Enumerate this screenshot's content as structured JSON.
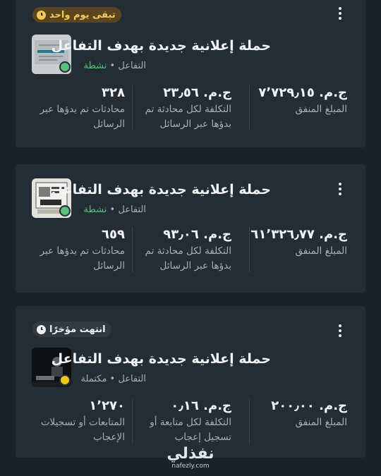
{
  "campaigns": [
    {
      "badge": "تبقى يوم واحد",
      "title": "حملة إعلانية جديدة بهدف التفاعل",
      "objective": "التفاعل",
      "status": "نشطة",
      "metrics": [
        {
          "value": "ج.م. ٧٬٧٢٩٫١٥",
          "label": "المبلغ المنفق"
        },
        {
          "value": "ج.م. ٢٣٫٥٦",
          "label": "التكلفة لكل محادثة تم بدؤها عبر الرسائل"
        },
        {
          "value": "٣٢٨",
          "label": "محادثات تم بدؤها عبر الرسائل"
        }
      ]
    },
    {
      "badge": "",
      "title": "حملة إعلانية جديدة بهدف التفاعل",
      "objective": "التفاعل",
      "status": "نشطة",
      "metrics": [
        {
          "value": "ج.م. ٦١٬٣٢٦٫٧٧",
          "label": "المبلغ المنفق"
        },
        {
          "value": "ج.م. ٩٣٫٠٦",
          "label": "التكلفة لكل محادثة تم بدؤها عبر الرسائل"
        },
        {
          "value": "٦٥٩",
          "label": "محادثات تم بدؤها عبر الرسائل"
        }
      ]
    },
    {
      "badge": "انتهت مؤخرًا",
      "title": "حملة إعلانية جديدة بهدف التفاعل",
      "objective": "التفاعل",
      "status": "مكتملة",
      "metrics": [
        {
          "value": "ج.م. ٢٠٠٫٠٠",
          "label": "المبلغ المنفق"
        },
        {
          "value": "ج.م. ٠٫١٦",
          "label": "التكلفة لكل متابعة أو تسجيل إعجاب"
        },
        {
          "value": "١٬٢٧٠",
          "label": "المتابعات أو تسجيلات الإعجاب"
        }
      ]
    }
  ],
  "separator": "•",
  "watermark": {
    "main": "نفذلي",
    "sub": "nafezly.com"
  },
  "colors": {
    "active": "#58c27a",
    "completed": "#f0c419",
    "warning_badge_bg": "#5b4520",
    "warning_badge_text": "#f3c95a"
  }
}
